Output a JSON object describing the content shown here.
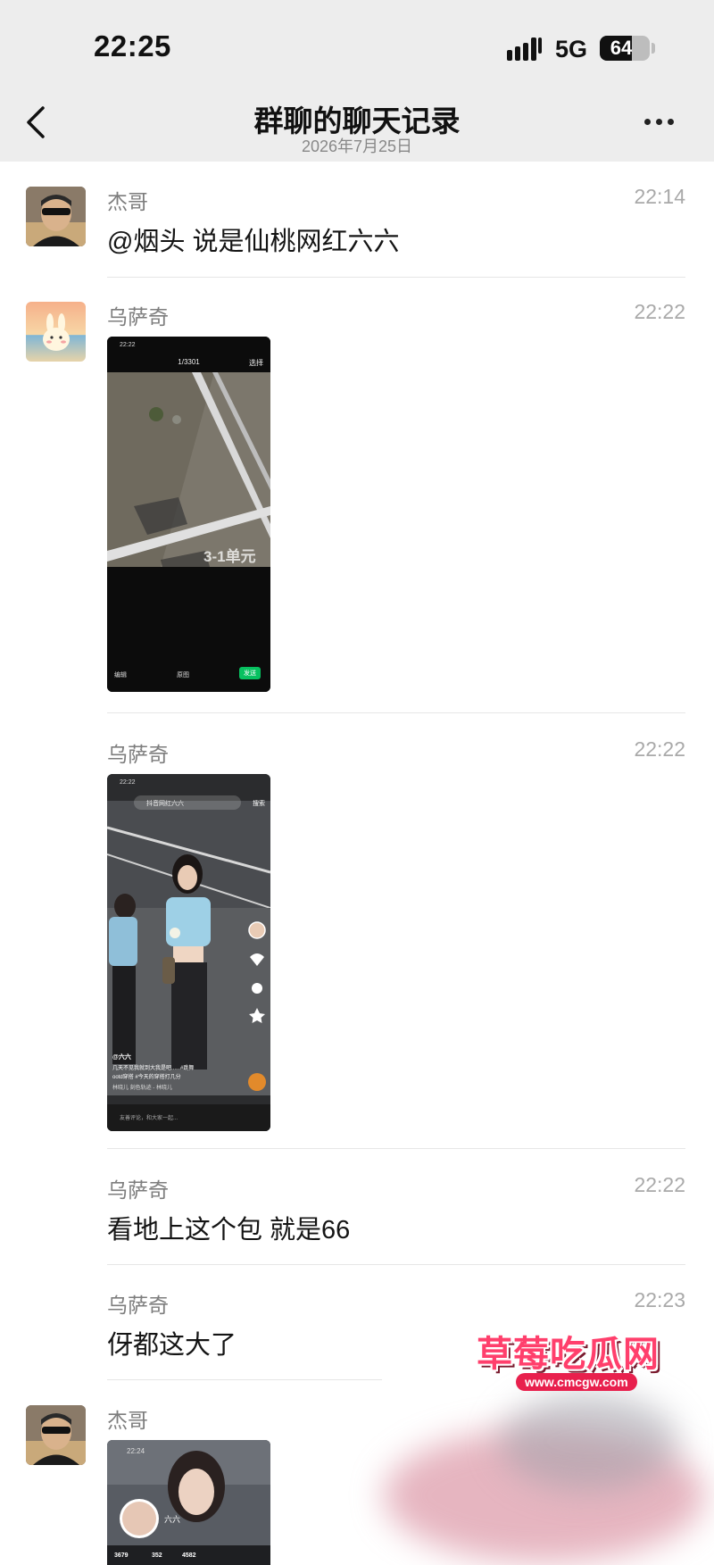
{
  "status_bar": {
    "time": "22:25",
    "network": "5G",
    "battery": "64",
    "battery_level": 0.64
  },
  "nav": {
    "title": "群聊的聊天记录",
    "subtitle": "2026年7月25日"
  },
  "messages": [
    {
      "sender": "杰哥",
      "time": "22:14",
      "text": "@烟头 说是仙桃网红六六"
    },
    {
      "sender": "乌萨奇",
      "time": "22:22",
      "image": {
        "status_time": "22:22",
        "counter": "1/3301",
        "select": "选择",
        "overlay": "3-1单元",
        "edit": "编辑",
        "original": "原图",
        "send": "发送"
      }
    },
    {
      "sender": "乌萨奇",
      "time": "22:22",
      "image": {
        "status_time": "22:22",
        "search": "抖音网红六六",
        "search_btn": "搜索",
        "user": "@六六",
        "caption": "几天不见我就到大我是吧......#跳舞",
        "caption2": "ootd穿搭 #今天的穿搭打几分",
        "music": "林晓儿  刻色轨迹 - 林晓儿",
        "comment": "友善评论，和大家一起..."
      }
    },
    {
      "sender": "乌萨奇",
      "time": "22:22",
      "text": "看地上这个包 就是66"
    },
    {
      "sender": "乌萨奇",
      "time": "22:23",
      "text": "伢都这大了"
    },
    {
      "sender": "杰哥",
      "time": "",
      "image": {
        "status_time": "22:24",
        "name": "六六",
        "stat1": "3679",
        "stat2": "352",
        "stat3": "4582"
      }
    }
  ],
  "watermark": {
    "title": "草莓吃瓜网",
    "url": "www.cmcgw.com"
  }
}
